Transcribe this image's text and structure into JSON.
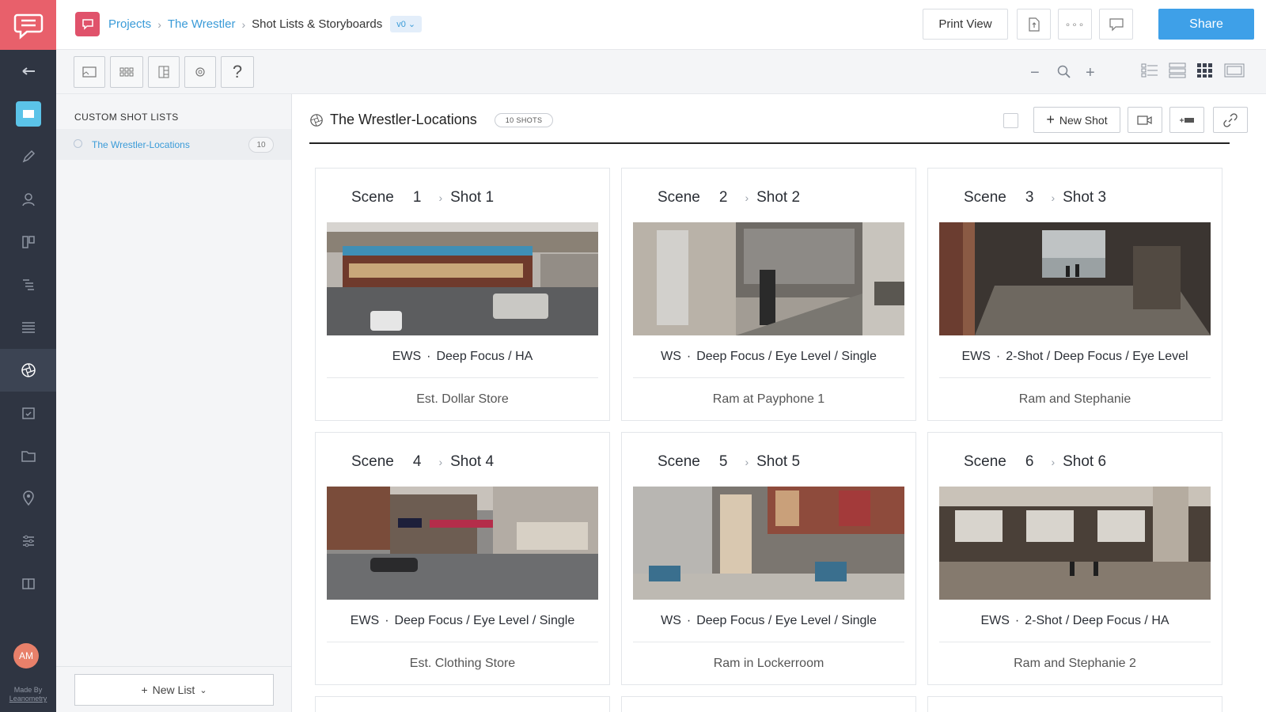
{
  "sidebar_rail": {
    "avatar_initials": "AM",
    "made_by_line1": "Made By",
    "made_by_line2": "Leanometry"
  },
  "topbar": {
    "breadcrumbs": [
      "Projects",
      "The Wrestler",
      "Shot Lists & Storyboards"
    ],
    "version": "v0",
    "print_view": "Print View",
    "share": "Share"
  },
  "panel": {
    "title": "CUSTOM SHOT LISTS",
    "items": [
      {
        "label": "The Wrestler-Locations",
        "count": "10"
      }
    ],
    "new_list": "New List"
  },
  "main": {
    "list_title": "The Wrestler-Locations",
    "shots_pill": "10 SHOTS",
    "new_shot": "New Shot"
  },
  "shots": [
    {
      "scene_label": "Scene",
      "scene": "1",
      "shot": "Shot 1",
      "size": "EWS",
      "specs": "Deep Focus / HA",
      "description": "Est. Dollar Store"
    },
    {
      "scene_label": "Scene",
      "scene": "2",
      "shot": "Shot 2",
      "size": "WS",
      "specs": "Deep Focus / Eye Level / Single",
      "description": "Ram at Payphone 1"
    },
    {
      "scene_label": "Scene",
      "scene": "3",
      "shot": "Shot 3",
      "size": "EWS",
      "specs": "2-Shot / Deep Focus / Eye Level",
      "description": "Ram and Stephanie"
    },
    {
      "scene_label": "Scene",
      "scene": "4",
      "shot": "Shot 4",
      "size": "EWS",
      "specs": "Deep Focus / Eye Level / Single",
      "description": "Est. Clothing Store"
    },
    {
      "scene_label": "Scene",
      "scene": "5",
      "shot": "Shot 5",
      "size": "WS",
      "specs": "Deep Focus / Eye Level / Single",
      "description": "Ram in Lockerroom"
    },
    {
      "scene_label": "Scene",
      "scene": "6",
      "shot": "Shot 6",
      "size": "EWS",
      "specs": "2-Shot / Deep Focus / HA",
      "description": "Ram and Stephanie 2"
    }
  ],
  "colors": {
    "accent": "#3ea0e8",
    "brand": "#e8606b",
    "rail": "#2f3542"
  }
}
